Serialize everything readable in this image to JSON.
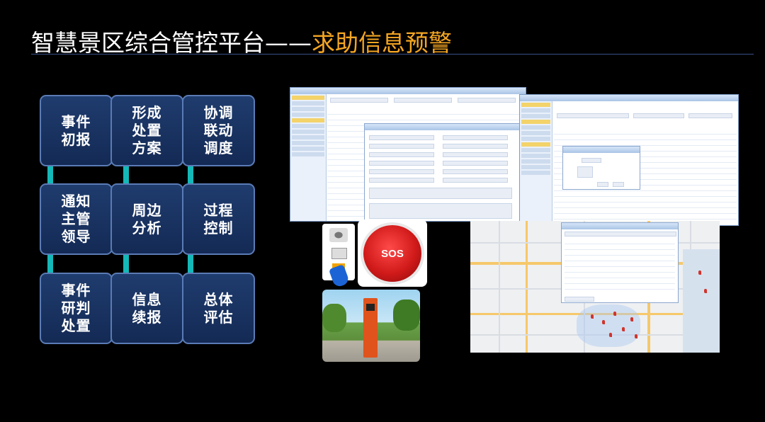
{
  "header": {
    "title_main": "智慧景区综合管控平台——",
    "title_accent": "求助信息预警"
  },
  "colors": {
    "accent": "#f5a623",
    "connector": "#14b8b8",
    "box_fill": "#1f3c6e",
    "rule": "#3a4f88"
  },
  "flow": {
    "boxes": [
      {
        "id": "report",
        "label": "事件初报"
      },
      {
        "id": "plan",
        "label": "形成处置方案"
      },
      {
        "id": "coordinate",
        "label": "协调联动调度"
      },
      {
        "id": "notify",
        "label": "通知主管领导"
      },
      {
        "id": "analyze",
        "label": "周边分析"
      },
      {
        "id": "control",
        "label": "过程控制"
      },
      {
        "id": "judge",
        "label": "事件研判处置"
      },
      {
        "id": "continue",
        "label": "信息续报"
      },
      {
        "id": "evaluate",
        "label": "总体评估"
      }
    ]
  },
  "screens": {
    "sos_label": "SOS"
  }
}
